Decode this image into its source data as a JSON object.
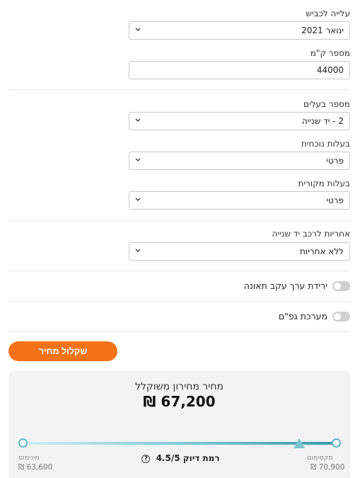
{
  "fields": {
    "registration_date": {
      "label": "עלייה לכביש",
      "value": "ינואר 2021"
    },
    "km": {
      "label": "מספר ק\"מ",
      "value": "44000"
    },
    "owners_count": {
      "label": "מספר בעלים",
      "value": "2 - יד שנייה"
    },
    "current_ownership": {
      "label": "בעלות נוכחית",
      "value": "פרטי"
    },
    "original_ownership": {
      "label": "בעלות מקורית",
      "value": "פרטי"
    },
    "warranty": {
      "label": "אחריות לרכב יד שנייה",
      "value": "ללא אחריות"
    }
  },
  "toggles": {
    "accident_depreciation": {
      "label": "ירידת ערך עקב תאונה",
      "on": false
    },
    "airbags": {
      "label": "מערכת גפ\"ם",
      "on": false
    }
  },
  "calculate_button": "שקלול מחיר",
  "result": {
    "title": "מחיר מחירון משוקלל",
    "price": "₪ 67,200",
    "min_label": "מינימום",
    "min_value": "₪ 63,600",
    "max_label": "מקסימום",
    "max_value": "₪ 70,900",
    "accuracy_label": "רמת דיוק",
    "accuracy_value": "4.5/5",
    "accuracy_help": "?"
  },
  "colors": {
    "accent": "#f47316",
    "range_teal": "#3b9aa8"
  },
  "icons": [
    "chevron-down-icon",
    "help-icon",
    "marker-triangle-icon"
  ]
}
